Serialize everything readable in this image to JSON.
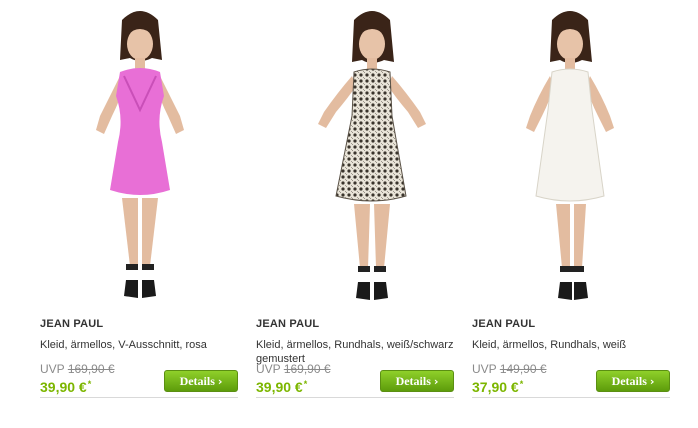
{
  "products": [
    {
      "brand": "JEAN PAUL",
      "description": "Kleid, ärmellos, V-Ausschnitt, rosa",
      "uvp_label": "UVP",
      "old_price": "169,90 €",
      "price": "39,90 €",
      "price_mark": "*",
      "details_label": "Details",
      "dress_color": "#e86fd6"
    },
    {
      "brand": "JEAN PAUL",
      "description": "Kleid, ärmellos, Rundhals, weiß/schwarz gemustert",
      "uvp_label": "UVP",
      "old_price": "169,90 €",
      "price": "39,90 €",
      "price_mark": "*",
      "details_label": "Details",
      "dress_color": "#8c8478"
    },
    {
      "brand": "JEAN PAUL",
      "description": "Kleid, ärmellos, Rundhals, weiß",
      "uvp_label": "UVP",
      "old_price": "149,90 €",
      "price": "37,90 €",
      "price_mark": "*",
      "details_label": "Details",
      "dress_color": "#f5f3ee"
    }
  ],
  "colors": {
    "price_green": "#7cb600",
    "button_green": "#6fb31a",
    "text": "#333333",
    "muted": "#8a8a8a"
  }
}
